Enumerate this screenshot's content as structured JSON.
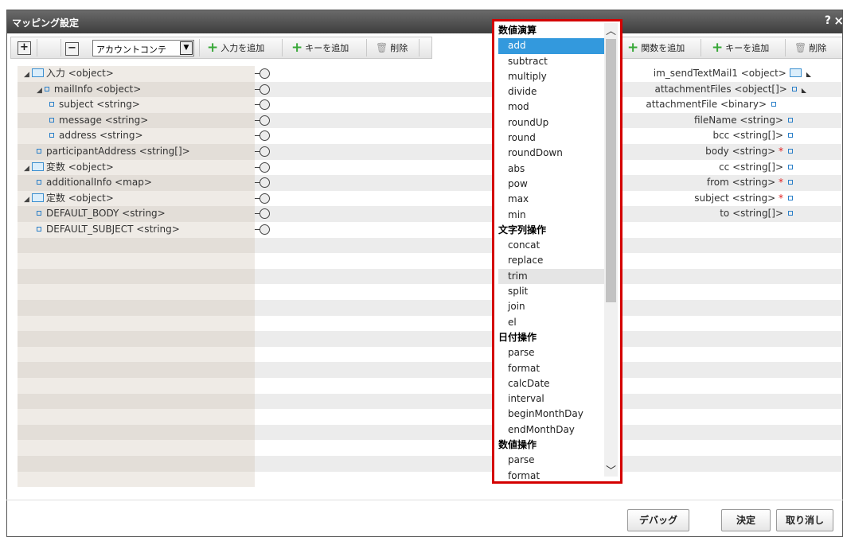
{
  "dialog": {
    "title": "マッピング設定",
    "help": "?",
    "close": "×"
  },
  "left_toolbar": {
    "expand": "+",
    "collapse": "−",
    "select_value": "アカウントコンテ",
    "add_input": "入力を追加",
    "add_key": "キーを追加",
    "delete": "削除"
  },
  "right_toolbar": {
    "add_function": "関数を追加",
    "add_key": "キーを追加",
    "delete": "削除"
  },
  "left_tree": [
    {
      "label": "入力 <object>",
      "kind": "folder",
      "indent": 0
    },
    {
      "label": "mailInfo <object>",
      "kind": "node",
      "indent": 1
    },
    {
      "label": "subject <string>",
      "kind": "leaf",
      "indent": 2
    },
    {
      "label": "message <string>",
      "kind": "leaf",
      "indent": 2
    },
    {
      "label": "address <string>",
      "kind": "leaf",
      "indent": 2
    },
    {
      "label": "participantAddress <string[]>",
      "kind": "leaf",
      "indent": 1
    },
    {
      "label": "変数 <object>",
      "kind": "folder",
      "indent": 0
    },
    {
      "label": "additionalInfo <map>",
      "kind": "leaf",
      "indent": 1
    },
    {
      "label": "定数 <object>",
      "kind": "folder",
      "indent": 0
    },
    {
      "label": "DEFAULT_BODY <string>",
      "kind": "leaf",
      "indent": 1
    },
    {
      "label": "DEFAULT_SUBJECT <string>",
      "kind": "leaf",
      "indent": 1
    }
  ],
  "right_tree": [
    {
      "label": "im_sendTextMail1 <object>",
      "required": false,
      "kind": "folder"
    },
    {
      "label": "attachmentFiles <object[]>",
      "required": false,
      "kind": "node"
    },
    {
      "label": "attachmentFile <binary>",
      "required": false,
      "kind": "leaf"
    },
    {
      "label": "fileName <string>",
      "required": false,
      "kind": "leaf"
    },
    {
      "label": "bcc <string[]>",
      "required": false,
      "kind": "leaf"
    },
    {
      "label": "body <string>",
      "required": true,
      "kind": "leaf"
    },
    {
      "label": "cc <string[]>",
      "required": false,
      "kind": "leaf"
    },
    {
      "label": "from <string>",
      "required": true,
      "kind": "leaf"
    },
    {
      "label": "subject <string>",
      "required": true,
      "kind": "leaf"
    },
    {
      "label": "to <string[]>",
      "required": false,
      "kind": "leaf"
    }
  ],
  "required_mark": "*",
  "function_dropdown": {
    "selected": "add",
    "hovered": "trim",
    "items": [
      {
        "type": "group",
        "label": "数値演算"
      },
      {
        "type": "option",
        "label": "add"
      },
      {
        "type": "option",
        "label": "subtract"
      },
      {
        "type": "option",
        "label": "multiply"
      },
      {
        "type": "option",
        "label": "divide"
      },
      {
        "type": "option",
        "label": "mod"
      },
      {
        "type": "option",
        "label": "roundUp"
      },
      {
        "type": "option",
        "label": "round"
      },
      {
        "type": "option",
        "label": "roundDown"
      },
      {
        "type": "option",
        "label": "abs"
      },
      {
        "type": "option",
        "label": "pow"
      },
      {
        "type": "option",
        "label": "max"
      },
      {
        "type": "option",
        "label": "min"
      },
      {
        "type": "group",
        "label": "文字列操作"
      },
      {
        "type": "option",
        "label": "concat"
      },
      {
        "type": "option",
        "label": "replace"
      },
      {
        "type": "option",
        "label": "trim"
      },
      {
        "type": "option",
        "label": "split"
      },
      {
        "type": "option",
        "label": "join"
      },
      {
        "type": "option",
        "label": "el"
      },
      {
        "type": "group",
        "label": "日付操作"
      },
      {
        "type": "option",
        "label": "parse"
      },
      {
        "type": "option",
        "label": "format"
      },
      {
        "type": "option",
        "label": "calcDate"
      },
      {
        "type": "option",
        "label": "interval"
      },
      {
        "type": "option",
        "label": "beginMonthDay"
      },
      {
        "type": "option",
        "label": "endMonthDay"
      },
      {
        "type": "group",
        "label": "数値操作"
      },
      {
        "type": "option",
        "label": "parse"
      },
      {
        "type": "option",
        "label": "format"
      }
    ]
  },
  "footer": {
    "debug": "デバッグ",
    "ok": "決定",
    "cancel": "取り消し"
  },
  "colors": {
    "selected": "#3399dd",
    "highlight_border": "#d40000",
    "required": "#e02020"
  }
}
